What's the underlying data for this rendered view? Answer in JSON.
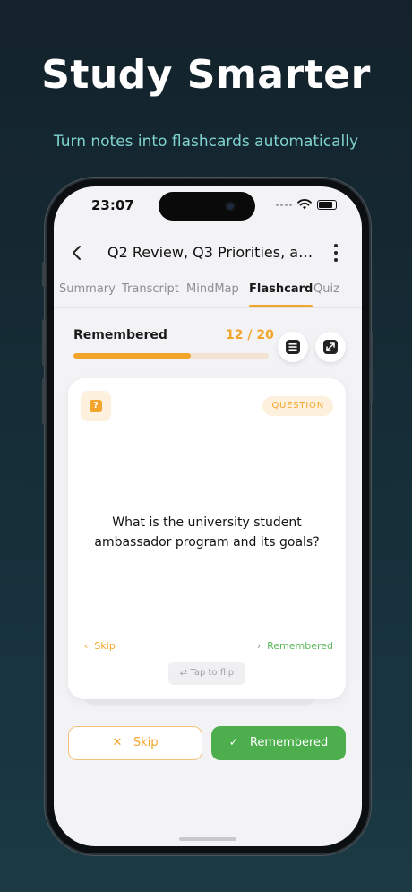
{
  "hero": {
    "title": "Study Smarter",
    "subtitle": "Turn notes into flashcards automatically"
  },
  "status_bar": {
    "time": "23:07"
  },
  "header": {
    "title": "Q2 Review, Q3 Priorities, and ...",
    "back_icon": "chevron-left-icon",
    "more_icon": "more-vertical-icon"
  },
  "tabs": [
    {
      "label": "Summary",
      "active": false
    },
    {
      "label": "Transcript",
      "active": false
    },
    {
      "label": "MindMap",
      "active": false
    },
    {
      "label": "Flashcard",
      "active": true
    },
    {
      "label": "Quiz",
      "active": false
    }
  ],
  "progress": {
    "label": "Remembered",
    "count": "12 / 20",
    "fraction": 0.6
  },
  "card": {
    "badge": "QUESTION",
    "question": "What is the university student ambassador program and its goals?",
    "skip_hint": "Skip",
    "remembered_hint": "Remembered",
    "tap_to_flip": "Tap to flip"
  },
  "actions": {
    "skip_label": "Skip",
    "remembered_label": "Remembered"
  },
  "colors": {
    "accent": "#f2a52a",
    "success": "#4cae4c",
    "hero_subtitle": "#7fd3d0"
  }
}
